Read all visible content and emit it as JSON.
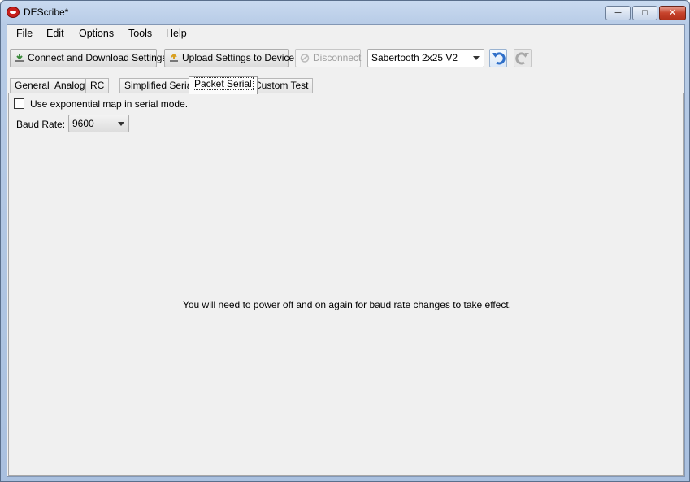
{
  "window": {
    "title": "DEScribe*",
    "icon": "app-logo-icon"
  },
  "caption_buttons": {
    "minimize": "minimize-icon",
    "maximize": "maximize-icon",
    "close": "close-icon"
  },
  "menu": [
    {
      "label": "File"
    },
    {
      "label": "Edit"
    },
    {
      "label": "Options"
    },
    {
      "label": "Tools"
    },
    {
      "label": "Help"
    }
  ],
  "toolbar": {
    "connect_label": "Connect and Download Settings",
    "upload_label": "Upload Settings to Device",
    "disconnect_label": "Disconnect",
    "device_selected": "Sabertooth 2x25 V2",
    "undo_icon": "undo-icon",
    "redo_icon": "redo-icon"
  },
  "tabs": [
    {
      "label": "General"
    },
    {
      "label": "Analog"
    },
    {
      "label": "RC"
    },
    {
      "label": "Simplified Serial"
    },
    {
      "label": "Packet Serial",
      "active": true
    },
    {
      "label": "Custom Test"
    }
  ],
  "panel": {
    "exp_map_label": "Use exponential map in serial mode.",
    "exp_map_checked": false,
    "baud_label": "Baud Rate:",
    "baud_value": "9600",
    "notice": "You will need to power off and on again for baud rate changes to take effect."
  },
  "colors": {
    "accent": "#3a7bd5",
    "title_bg": "#c9daf0",
    "close": "#c7432c"
  }
}
